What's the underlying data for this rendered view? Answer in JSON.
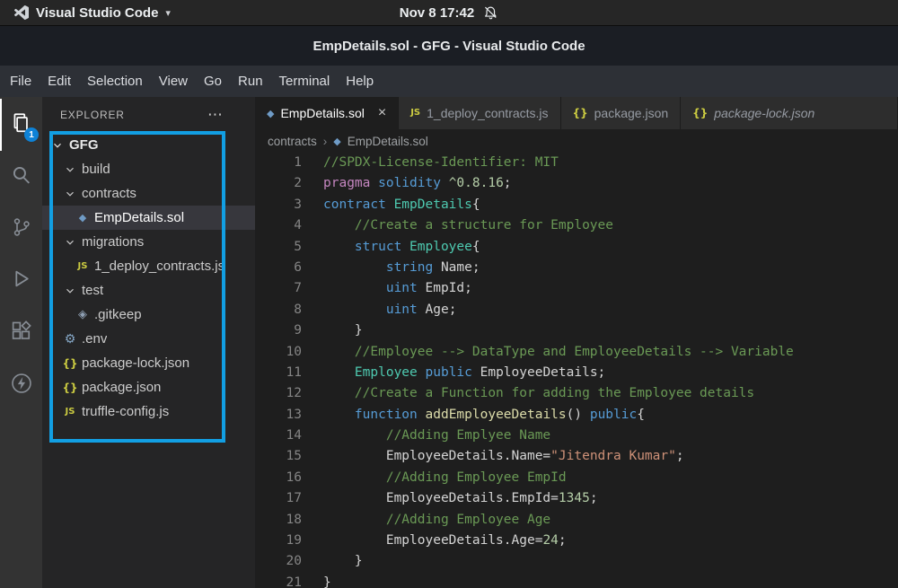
{
  "system_bar": {
    "app_name": "Visual Studio Code",
    "caret": "▾",
    "clock": "Nov 8 17:42"
  },
  "title_bar": {
    "title": "EmpDetails.sol - GFG - Visual Studio Code"
  },
  "menu_bar": {
    "items": [
      "File",
      "Edit",
      "Selection",
      "View",
      "Go",
      "Run",
      "Terminal",
      "Help"
    ]
  },
  "activity_bar": {
    "items": [
      {
        "id": "explorer",
        "icon": "files-icon",
        "active": true,
        "badge": "1"
      },
      {
        "id": "search",
        "icon": "search-icon"
      },
      {
        "id": "source-control",
        "icon": "source-control-icon"
      },
      {
        "id": "run-debug",
        "icon": "run-debug-icon"
      },
      {
        "id": "extensions",
        "icon": "extensions-icon"
      },
      {
        "id": "lightning",
        "icon": "lightning-icon"
      }
    ]
  },
  "sidebar": {
    "header": "EXPLORER",
    "more_actions": "⋯",
    "tree": [
      {
        "label": "GFG",
        "icon": "chevron",
        "level": 0,
        "bold": true
      },
      {
        "label": "build",
        "icon": "chevron",
        "level": 1
      },
      {
        "label": "contracts",
        "icon": "chevron",
        "level": 1
      },
      {
        "label": "EmpDetails.sol",
        "icon": "solidity",
        "level": 2,
        "selected": true
      },
      {
        "label": "migrations",
        "icon": "chevron",
        "level": 1
      },
      {
        "label": "1_deploy_contracts.js",
        "icon": "js",
        "level": 2
      },
      {
        "label": "test",
        "icon": "chevron",
        "level": 1
      },
      {
        "label": ".gitkeep",
        "icon": "git",
        "level": 2
      },
      {
        "label": ".env",
        "icon": "gear",
        "level": 1
      },
      {
        "label": "package-lock.json",
        "icon": "json",
        "level": 1
      },
      {
        "label": "package.json",
        "icon": "json",
        "level": 1
      },
      {
        "label": "truffle-config.js",
        "icon": "js",
        "level": 1
      }
    ]
  },
  "editor": {
    "tabs": [
      {
        "label": "EmpDetails.sol",
        "icon": "solidity",
        "active": true,
        "close": "×"
      },
      {
        "label": "1_deploy_contracts.js",
        "icon": "js"
      },
      {
        "label": "package.json",
        "icon": "json"
      },
      {
        "label": "package-lock.json",
        "icon": "json",
        "preview": true,
        "fill": true
      }
    ],
    "breadcrumb": {
      "folder": "contracts",
      "separator": "›",
      "file": "EmpDetails.sol",
      "file_icon": "solidity"
    },
    "code_lines": [
      {
        "n": 1,
        "s": [
          [
            "cm",
            "//SPDX-License-Identifier: MIT"
          ]
        ]
      },
      {
        "n": 2,
        "s": [
          [
            "ctrl",
            "pragma "
          ],
          [
            "kw",
            "solidity "
          ],
          [
            "num",
            "^0.8.16"
          ],
          [
            "def",
            ";"
          ]
        ]
      },
      {
        "n": 3,
        "s": [
          [
            "kw",
            "contract "
          ],
          [
            "type",
            "EmpDetails"
          ],
          [
            "def",
            "{"
          ]
        ]
      },
      {
        "n": 4,
        "s": [
          [
            "cm",
            "    //Create a structure for Employee"
          ]
        ]
      },
      {
        "n": 5,
        "s": [
          [
            "def",
            "    "
          ],
          [
            "kw",
            "struct "
          ],
          [
            "type",
            "Employee"
          ],
          [
            "def",
            "{"
          ]
        ]
      },
      {
        "n": 6,
        "s": [
          [
            "def",
            "        "
          ],
          [
            "kw",
            "string "
          ],
          [
            "def",
            "Name;"
          ]
        ]
      },
      {
        "n": 7,
        "s": [
          [
            "def",
            "        "
          ],
          [
            "kw",
            "uint "
          ],
          [
            "def",
            "EmpId;"
          ]
        ]
      },
      {
        "n": 8,
        "s": [
          [
            "def",
            "        "
          ],
          [
            "kw",
            "uint "
          ],
          [
            "def",
            "Age;"
          ]
        ]
      },
      {
        "n": 9,
        "s": [
          [
            "def",
            "    }"
          ]
        ]
      },
      {
        "n": 10,
        "s": [
          [
            "cm",
            "    //Employee --> DataType and EmployeeDetails --> Variable"
          ]
        ]
      },
      {
        "n": 11,
        "s": [
          [
            "def",
            "    "
          ],
          [
            "type",
            "Employee "
          ],
          [
            "kw",
            "public "
          ],
          [
            "def",
            "EmployeeDetails;"
          ]
        ]
      },
      {
        "n": 12,
        "s": [
          [
            "cm",
            "    //Create a Function for adding the Employee details"
          ]
        ]
      },
      {
        "n": 13,
        "s": [
          [
            "def",
            "    "
          ],
          [
            "kw",
            "function "
          ],
          [
            "fn",
            "addEmployeeDetails"
          ],
          [
            "def",
            "() "
          ],
          [
            "kw",
            "public"
          ],
          [
            "def",
            "{"
          ]
        ]
      },
      {
        "n": 14,
        "s": [
          [
            "cm",
            "        //Adding Emplyee Name"
          ]
        ]
      },
      {
        "n": 15,
        "s": [
          [
            "def",
            "        EmployeeDetails.Name="
          ],
          [
            "str",
            "\"Jitendra Kumar\""
          ],
          [
            "def",
            ";"
          ]
        ]
      },
      {
        "n": 16,
        "s": [
          [
            "cm",
            "        //Adding Employee EmpId"
          ]
        ]
      },
      {
        "n": 17,
        "s": [
          [
            "def",
            "        EmployeeDetails.EmpId="
          ],
          [
            "num",
            "1345"
          ],
          [
            "def",
            ";"
          ]
        ]
      },
      {
        "n": 18,
        "s": [
          [
            "cm",
            "        //Adding Employee Age"
          ]
        ]
      },
      {
        "n": 19,
        "s": [
          [
            "def",
            "        EmployeeDetails.Age="
          ],
          [
            "num",
            "24"
          ],
          [
            "def",
            ";"
          ]
        ]
      },
      {
        "n": 20,
        "s": [
          [
            "def",
            "    }"
          ]
        ]
      },
      {
        "n": 21,
        "s": [
          [
            "def",
            "}"
          ]
        ]
      }
    ]
  },
  "colors": {
    "cm": "#6A9955",
    "kw": "#569CD6",
    "ctrl": "#C586C0",
    "type": "#4EC9B0",
    "fn": "#DCDCAA",
    "str": "#CE9178",
    "num": "#B5CEA8",
    "def": "#D4D4D4",
    "badge": "#0e82d6",
    "annotation": "#129fe3"
  }
}
